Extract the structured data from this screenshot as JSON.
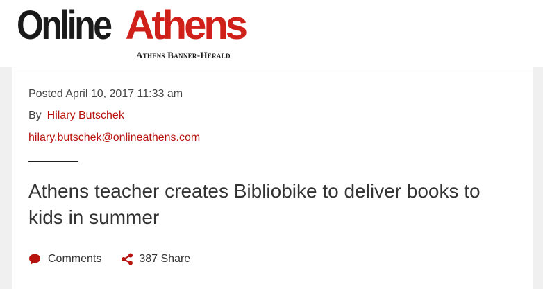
{
  "brand": {
    "logo_part1": "Online",
    "logo_part2": "Athens",
    "subtitle": "Athens Banner-Herald"
  },
  "article": {
    "posted": "Posted April 10, 2017 11:33 am",
    "by_label": "By",
    "author": "Hilary Butschek",
    "email": "hilary.butschek@onlineathens.com",
    "title": "Athens teacher creates Bibliobike to deliver books to kids in summer"
  },
  "actions": {
    "comments_label": "Comments",
    "share_label": "387 Share"
  },
  "icons": {
    "comment": "comment-bubble-icon",
    "share": "share-icon"
  },
  "colors": {
    "accent": "#b7130e",
    "logo_red": "#d0201a",
    "text": "#333333"
  }
}
